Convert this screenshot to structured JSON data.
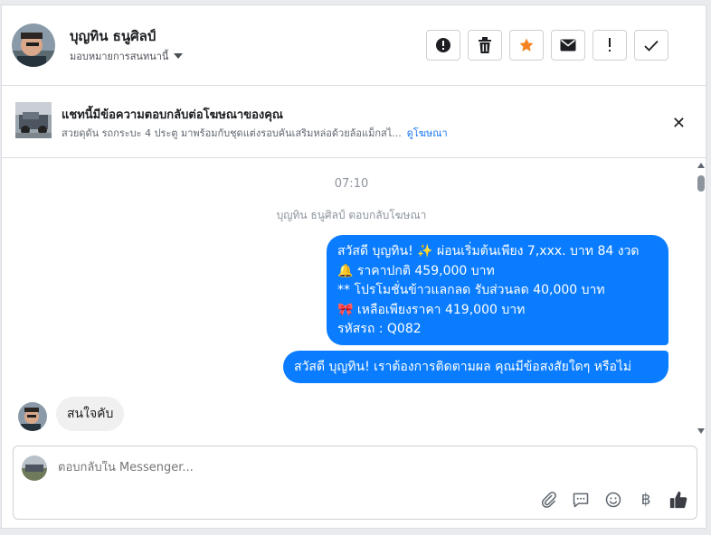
{
  "header": {
    "contact_name": "บุญทิน ธนูศิลป์",
    "assign_label": "มอบหมายการสนทนานี้",
    "actions": [
      {
        "name": "spam-report-icon",
        "glyph": "❗"
      },
      {
        "name": "trash-icon",
        "glyph": "🗑"
      },
      {
        "name": "star-icon",
        "glyph": "★"
      },
      {
        "name": "envelope-icon",
        "glyph": "✉"
      },
      {
        "name": "exclamation-icon",
        "glyph": "!"
      },
      {
        "name": "checkmark-icon",
        "glyph": "✓"
      }
    ]
  },
  "ad": {
    "title": "แชทนี้มีข้อความตอบกลับต่อโฆษณาของคุณ",
    "subtitle": "สวยดุดัน รถกระบะ 4 ประตู มาพร้อมกับชุดแต่งรอบคันเสริมหล่อด้วยล้อแม็กสไ...",
    "link": "ดูโฆษณา",
    "close_glyph": "✕"
  },
  "messages": {
    "time": "07:10",
    "reply_note": "บุญทิน ธนูศิลป์ ตอบกลับโฆษณา",
    "outgoing_1_lines": [
      "สวัสดี บุญทิน! ✨  ผ่อนเริ่มต้นเพียง 7,xxx. บาท 84 งวด",
      "🔔 ราคาปกติ 459,000 บาท",
      "** โปรโมชั่นข้าวแลกลด รับส่วนลด 40,000 บาท",
      "🎀  เหลือเพียงราคา 419,000 บาท",
      " รหัสรถ : Q082"
    ],
    "outgoing_2": "สวัสดี บุญทิน! เราต้องการติดตามผล คุณมีข้อสงสัยใดๆ หรือไม่",
    "incoming_1": "สนใจคับ"
  },
  "composer": {
    "placeholder": "ตอบกลับใน Messenger...",
    "tools": [
      {
        "name": "paperclip-icon",
        "glyph": "📎"
      },
      {
        "name": "saved-reply-icon",
        "glyph": "💬"
      },
      {
        "name": "emoji-icon",
        "glyph": "☺"
      },
      {
        "name": "baht-payment-icon",
        "glyph": "฿"
      },
      {
        "name": "thumbs-up-icon",
        "glyph": "👍"
      }
    ]
  },
  "colors": {
    "accent": "#0a7cff",
    "link": "#1877f2",
    "star": "#f5821f"
  }
}
